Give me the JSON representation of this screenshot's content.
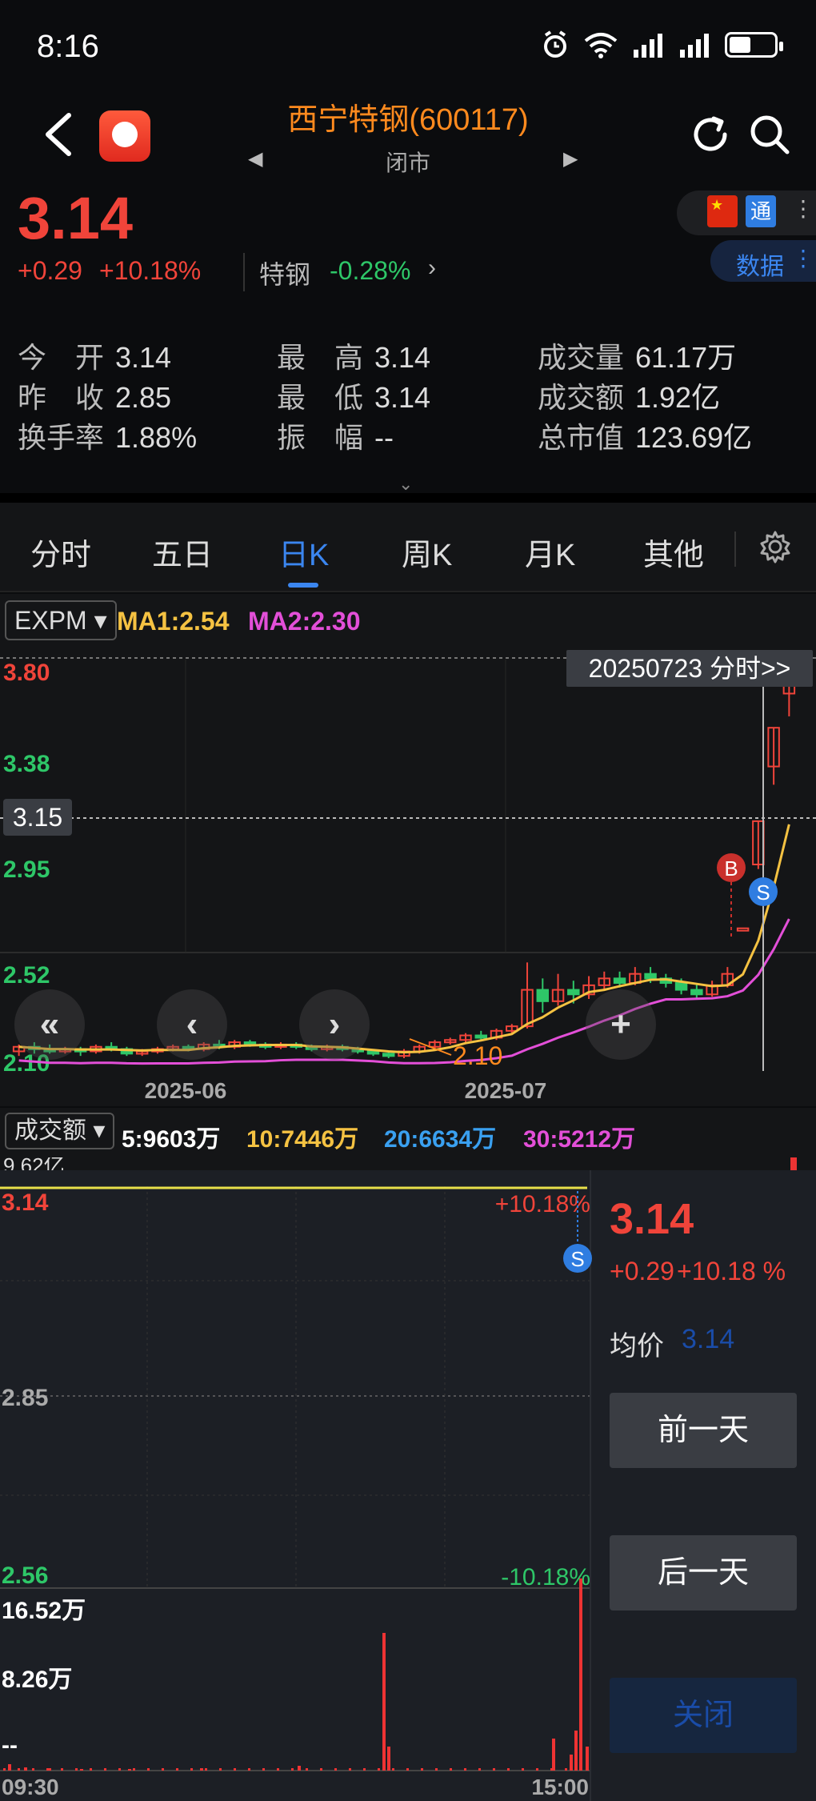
{
  "status": {
    "time": "8:16"
  },
  "header": {
    "title": "西宁特钢(600117)",
    "market_status": "闭市",
    "nav_prev": "◀",
    "nav_next": "▶"
  },
  "quote": {
    "price": "3.14",
    "change": "+0.29",
    "change_pct": "+10.18%",
    "sector_name": "特钢",
    "sector_change": "-0.28%",
    "sector_arrow": "›",
    "flag_label": "★",
    "tong_label": "通",
    "data_label": "数据",
    "stats": [
      {
        "k": "今　开",
        "v": "3.14"
      },
      {
        "k": "最　高",
        "v": "3.14"
      },
      {
        "k": "成交量",
        "v": "61.17万"
      },
      {
        "k": "昨　收",
        "v": "2.85"
      },
      {
        "k": "最　低",
        "v": "3.14"
      },
      {
        "k": "成交额",
        "v": "1.92亿"
      },
      {
        "k": "换手率",
        "v": "1.88%"
      },
      {
        "k": "振　幅",
        "v": "--"
      },
      {
        "k": "总市值",
        "v": "123.69亿"
      }
    ]
  },
  "tabs": [
    {
      "label": "分时",
      "active": false
    },
    {
      "label": "五日",
      "active": false
    },
    {
      "label": "日K",
      "active": true
    },
    {
      "label": "周K",
      "active": false
    },
    {
      "label": "月K",
      "active": false
    },
    {
      "label": "其他",
      "active": false
    }
  ],
  "kline": {
    "indicator": "EXPM ▾",
    "ma1": "MA1:2.54",
    "ma2": "MA2:2.30",
    "y_ticks": [
      "3.80",
      "3.38",
      "2.95",
      "2.52",
      "2.10"
    ],
    "crosshair_price": "3.15",
    "date_tip": "20250723 分时>>",
    "x_ticks": [
      "2025-06",
      "2025-07"
    ],
    "low_annotation": "2.10",
    "buy_marker": "B",
    "sell_marker": "S",
    "nav_buttons": [
      "«",
      "‹",
      "›",
      "+"
    ]
  },
  "volume_row": {
    "selector": "成交额 ▾",
    "items": [
      {
        "label": "5:9603万",
        "color": "#ffffff"
      },
      {
        "label": "10:7446万",
        "color": "#f5c242"
      },
      {
        "label": "20:6634万",
        "color": "#3aa0f0"
      },
      {
        "label": "30:5212万",
        "color": "#e34fd8"
      }
    ],
    "partial_label": "9.62亿"
  },
  "intraday": {
    "price_top": "3.14",
    "price_mid": "2.85",
    "price_bottom": "2.56",
    "pct_top": "+10.18%",
    "pct_bottom": "-10.18%",
    "sell_marker": "S",
    "vol_top": "16.52万",
    "vol_mid": "8.26万",
    "vol_zero": "--",
    "time_start": "09:30",
    "time_end": "15:00",
    "side_price": "3.14",
    "side_change": "+0.29",
    "side_pct": "+10.18 %",
    "avg_label": "均价",
    "avg_value": "3.14",
    "prev_day": "前一天",
    "next_day": "后一天",
    "close": "关闭"
  },
  "chart_data": {
    "type": "candlestick",
    "ylim": [
      2.1,
      3.8
    ],
    "x_ticks": [
      "2025-06",
      "2025-07"
    ],
    "candles": [
      [
        2.13,
        2.15,
        2.11,
        2.16
      ],
      [
        2.15,
        2.14,
        2.12,
        2.17
      ],
      [
        2.14,
        2.13,
        2.12,
        2.16
      ],
      [
        2.13,
        2.14,
        2.12,
        2.15
      ],
      [
        2.14,
        2.13,
        2.11,
        2.15
      ],
      [
        2.13,
        2.15,
        2.12,
        2.16
      ],
      [
        2.15,
        2.14,
        2.13,
        2.17
      ],
      [
        2.14,
        2.12,
        2.11,
        2.15
      ],
      [
        2.12,
        2.13,
        2.11,
        2.14
      ],
      [
        2.13,
        2.14,
        2.12,
        2.15
      ],
      [
        2.14,
        2.15,
        2.13,
        2.16
      ],
      [
        2.15,
        2.14,
        2.13,
        2.16
      ],
      [
        2.14,
        2.16,
        2.13,
        2.17
      ],
      [
        2.16,
        2.15,
        2.14,
        2.18
      ],
      [
        2.15,
        2.17,
        2.14,
        2.18
      ],
      [
        2.17,
        2.16,
        2.15,
        2.18
      ],
      [
        2.16,
        2.15,
        2.14,
        2.17
      ],
      [
        2.15,
        2.16,
        2.14,
        2.17
      ],
      [
        2.16,
        2.15,
        2.14,
        2.17
      ],
      [
        2.15,
        2.14,
        2.13,
        2.16
      ],
      [
        2.14,
        2.15,
        2.13,
        2.16
      ],
      [
        2.15,
        2.14,
        2.13,
        2.16
      ],
      [
        2.14,
        2.13,
        2.12,
        2.15
      ],
      [
        2.13,
        2.12,
        2.11,
        2.14
      ],
      [
        2.12,
        2.11,
        2.1,
        2.13
      ],
      [
        2.11,
        2.13,
        2.1,
        2.14
      ],
      [
        2.13,
        2.15,
        2.12,
        2.16
      ],
      [
        2.15,
        2.17,
        2.14,
        2.18
      ],
      [
        2.17,
        2.18,
        2.16,
        2.19
      ],
      [
        2.18,
        2.2,
        2.17,
        2.21
      ],
      [
        2.2,
        2.19,
        2.18,
        2.22
      ],
      [
        2.19,
        2.22,
        2.18,
        2.23
      ],
      [
        2.22,
        2.24,
        2.21,
        2.25
      ],
      [
        2.24,
        2.4,
        2.23,
        2.52
      ],
      [
        2.4,
        2.35,
        2.3,
        2.45
      ],
      [
        2.35,
        2.4,
        2.33,
        2.47
      ],
      [
        2.4,
        2.38,
        2.34,
        2.44
      ],
      [
        2.38,
        2.42,
        2.36,
        2.46
      ],
      [
        2.42,
        2.45,
        2.4,
        2.48
      ],
      [
        2.45,
        2.43,
        2.41,
        2.48
      ],
      [
        2.43,
        2.47,
        2.42,
        2.5
      ],
      [
        2.47,
        2.45,
        2.43,
        2.5
      ],
      [
        2.45,
        2.43,
        2.41,
        2.47
      ],
      [
        2.43,
        2.4,
        2.38,
        2.45
      ],
      [
        2.4,
        2.38,
        2.36,
        2.43
      ],
      [
        2.38,
        2.42,
        2.37,
        2.44
      ],
      [
        2.42,
        2.47,
        2.41,
        2.5
      ],
      [
        2.67,
        2.67,
        2.67,
        2.67
      ],
      [
        2.95,
        3.14,
        2.93,
        3.14
      ],
      [
        3.38,
        3.55,
        3.3,
        3.55
      ],
      [
        3.7,
        3.8,
        3.6,
        3.82
      ]
    ],
    "ma1_label": "MA1:2.54",
    "ma2_label": "MA2:2.30",
    "intraday": {
      "price": 3.14,
      "price_range": [
        2.56,
        3.14
      ],
      "volume_max": "16.52万"
    }
  }
}
